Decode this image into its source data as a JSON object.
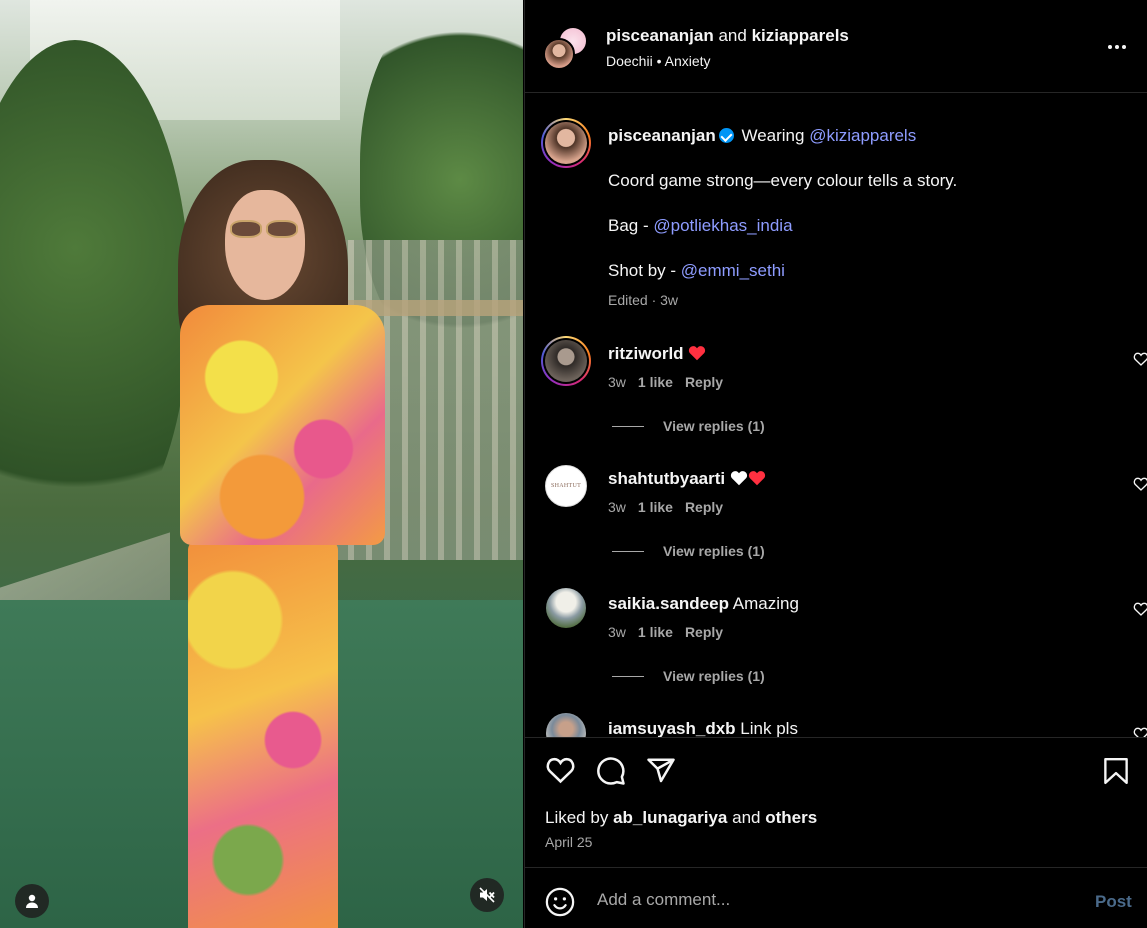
{
  "header": {
    "user1": "pisceananjan",
    "joiner": "and",
    "user2": "kiziapparels",
    "audio_artist": "Doechii",
    "audio_sep": "•",
    "audio_track": "Anxiety"
  },
  "caption": {
    "username": "pisceananjan",
    "prefix": "Wearing",
    "mention": "@kiziapparels",
    "line1": "Coord game strong—every colour tells a story.",
    "bag_label": "Bag - ",
    "bag_mention": "@potliekhas_india",
    "shot_label": "Shot by - ",
    "shot_mention": "@emmi_sethi",
    "meta": "Edited · 3w"
  },
  "comments": [
    {
      "username": "ritziworld",
      "text": "",
      "time": "3w",
      "likes": "1 like",
      "reply": "Reply",
      "view_replies": "View replies (1)"
    },
    {
      "username": "shahtutbyaarti",
      "text": "",
      "time": "3w",
      "likes": "1 like",
      "reply": "Reply",
      "view_replies": "View replies (1)",
      "avatar_text": "SHAHTUT"
    },
    {
      "username": "saikia.sandeep",
      "text": "Amazing",
      "time": "3w",
      "likes": "1 like",
      "reply": "Reply",
      "view_replies": "View replies (1)"
    },
    {
      "username": "iamsuyash_dxb",
      "text": "Link pls"
    }
  ],
  "likes": {
    "prefix": "Liked by",
    "user": "ab_lunagariya",
    "joiner": "and",
    "others": "others"
  },
  "date": "April 25",
  "add_comment": {
    "placeholder": "Add a comment...",
    "post": "Post"
  },
  "icons": {
    "heart": "heart-icon",
    "comment": "comment-icon",
    "share": "share-icon",
    "save": "bookmark-icon",
    "more": "more-icon",
    "emoji": "emoji-icon",
    "mute": "muted-icon",
    "user": "user-icon"
  },
  "colors": {
    "link": "#8e9cff",
    "verified": "#0095f6",
    "heart_red": "#ff3040",
    "post_disabled": "#4a6a8a"
  }
}
